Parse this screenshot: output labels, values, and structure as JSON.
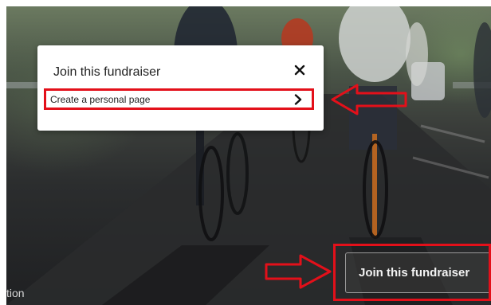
{
  "modal": {
    "title": "Join this fundraiser",
    "option_label": "Create a personal page"
  },
  "main": {
    "join_button_label": "Join this fundraiser",
    "bottom_partial_text": "tion"
  },
  "icons": {
    "close": "close-icon",
    "chevron": "chevron-right-icon",
    "annotation_arrow": "arrow-icon"
  },
  "colors": {
    "annotation_red": "#e3101a",
    "modal_bg": "#ffffff",
    "join_button_text": "#f2f2f2"
  }
}
